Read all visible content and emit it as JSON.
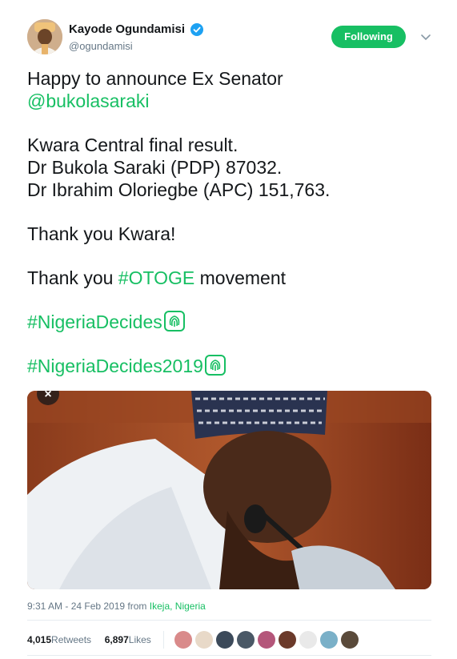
{
  "author": {
    "display_name": "Kayode Ogundamisi",
    "handle": "@ogundamisi",
    "verified": true
  },
  "follow_button": {
    "label": "Following",
    "color": "#17bf63"
  },
  "tweet": {
    "line1": "Happy to announce Ex Senator",
    "mention": "@bukolasaraki",
    "result_heading": "Kwara Central final result.",
    "result_1": "Dr Bukola Saraki (PDP) 87032.",
    "result_2": "Dr Ibrahim Oloriegbe (APC) 151,763.",
    "thanks_1": "Thank you Kwara!",
    "thanks_2_prefix": "Thank you ",
    "thanks_2_hashtag": "#OTOGE",
    "thanks_2_suffix": " movement",
    "hashtag_1": "#NigeriaDecides",
    "hashtag_2": "#NigeriaDecides2019",
    "hashtag_emoji_icon": "fingerprint-icon"
  },
  "media": {
    "close_glyph": "×"
  },
  "meta": {
    "timestamp": "9:31 AM - 24 Feb 2019",
    "from_label": " from ",
    "place": "Ikeja, Nigeria"
  },
  "stats": {
    "retweets_count": "4,015",
    "retweets_label": " Retweets",
    "likes_count": "6,897",
    "likes_label": " Likes"
  },
  "likers_colors": [
    "#d98a8a",
    "#e8d9c8",
    "#3c4a5a",
    "#4a5866",
    "#b4567a",
    "#6b3a2a",
    "#e9e9e9",
    "#7ab0c8",
    "#5a4a3a"
  ],
  "accent_color": "#17bf63"
}
